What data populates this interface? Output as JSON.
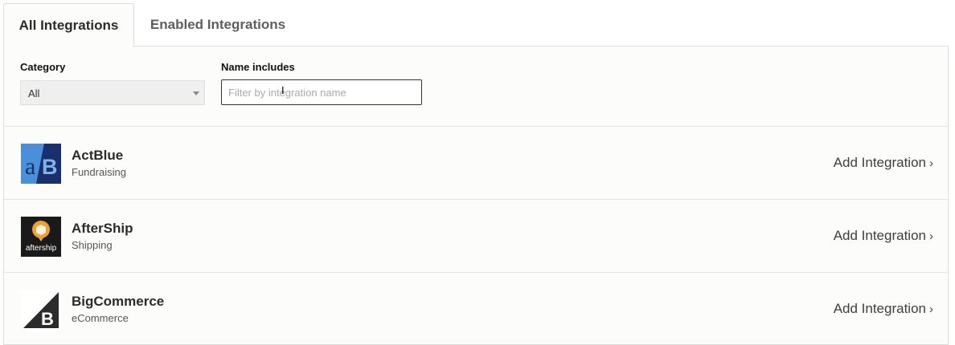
{
  "tabs": [
    {
      "label": "All Integrations",
      "active": true
    },
    {
      "label": "Enabled Integrations",
      "active": false
    }
  ],
  "filters": {
    "category_label": "Category",
    "category_value": "All",
    "name_label": "Name includes",
    "name_placeholder": "Filter by integration name",
    "name_value": ""
  },
  "integrations": [
    {
      "name": "ActBlue",
      "category": "Fundraising",
      "action": "Add Integration",
      "icon": "actblue-logo"
    },
    {
      "name": "AfterShip",
      "category": "Shipping",
      "action": "Add Integration",
      "icon": "aftership-logo",
      "logo_text": "aftership"
    },
    {
      "name": "BigCommerce",
      "category": "eCommerce",
      "action": "Add Integration",
      "icon": "bigcommerce-logo"
    }
  ],
  "colors": {
    "actblue_light": "#4a90d9",
    "actblue_dark": "#1b2f6e",
    "aftership_bg": "#1a1a1a",
    "aftership_orange": "#f0a030",
    "bigcommerce_dark": "#2b2b2b"
  }
}
